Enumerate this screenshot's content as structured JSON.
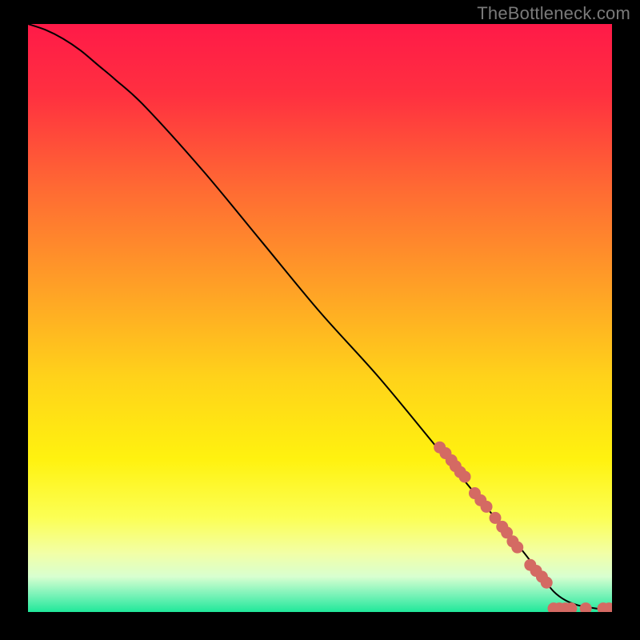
{
  "watermark": "TheBottleneck.com",
  "chart_data": {
    "type": "line",
    "title": "",
    "xlabel": "",
    "ylabel": "",
    "xlim": [
      0,
      100
    ],
    "ylim": [
      0,
      100
    ],
    "grid": false,
    "legend": false,
    "background": {
      "type": "vertical-gradient",
      "stops": [
        {
          "offset": 0.0,
          "color": "#ff1a48"
        },
        {
          "offset": 0.12,
          "color": "#ff3040"
        },
        {
          "offset": 0.28,
          "color": "#ff6a33"
        },
        {
          "offset": 0.45,
          "color": "#ffa126"
        },
        {
          "offset": 0.6,
          "color": "#ffd21a"
        },
        {
          "offset": 0.74,
          "color": "#fff20f"
        },
        {
          "offset": 0.84,
          "color": "#fcff55"
        },
        {
          "offset": 0.9,
          "color": "#f2ffa6"
        },
        {
          "offset": 0.94,
          "color": "#d8ffd0"
        },
        {
          "offset": 0.97,
          "color": "#7cf3b9"
        },
        {
          "offset": 1.0,
          "color": "#20e89a"
        }
      ]
    },
    "series": [
      {
        "name": "bottleneck-curve",
        "color": "#000000",
        "x": [
          0,
          3,
          6,
          9,
          12,
          15,
          20,
          30,
          40,
          50,
          60,
          70,
          80,
          85,
          88,
          90,
          92,
          94,
          96,
          98,
          100
        ],
        "y": [
          100,
          99,
          97.5,
          95.5,
          93,
          90.5,
          86,
          75,
          63,
          51,
          40,
          28,
          16,
          10,
          6,
          3.5,
          2,
          1.2,
          0.8,
          0.5,
          0.4
        ]
      }
    ],
    "scatter": {
      "name": "highlight-points",
      "color": "#d46a63",
      "radius": 7.5,
      "points": [
        {
          "x": 70.5,
          "y": 28.0
        },
        {
          "x": 71.5,
          "y": 27.0
        },
        {
          "x": 72.5,
          "y": 25.8
        },
        {
          "x": 73.2,
          "y": 24.8
        },
        {
          "x": 74.0,
          "y": 23.8
        },
        {
          "x": 74.8,
          "y": 23.0
        },
        {
          "x": 76.5,
          "y": 20.2
        },
        {
          "x": 77.5,
          "y": 19.0
        },
        {
          "x": 78.5,
          "y": 17.9
        },
        {
          "x": 80.0,
          "y": 16.0
        },
        {
          "x": 81.2,
          "y": 14.5
        },
        {
          "x": 82.0,
          "y": 13.5
        },
        {
          "x": 83.0,
          "y": 12.0
        },
        {
          "x": 83.8,
          "y": 11.0
        },
        {
          "x": 86.0,
          "y": 8.0
        },
        {
          "x": 87.0,
          "y": 7.0
        },
        {
          "x": 88.0,
          "y": 6.0
        },
        {
          "x": 88.8,
          "y": 5.0
        },
        {
          "x": 90.0,
          "y": 0.6
        },
        {
          "x": 91.0,
          "y": 0.6
        },
        {
          "x": 92.0,
          "y": 0.6
        },
        {
          "x": 93.0,
          "y": 0.6
        },
        {
          "x": 95.5,
          "y": 0.6
        },
        {
          "x": 98.5,
          "y": 0.6
        },
        {
          "x": 99.5,
          "y": 0.6
        }
      ]
    }
  }
}
